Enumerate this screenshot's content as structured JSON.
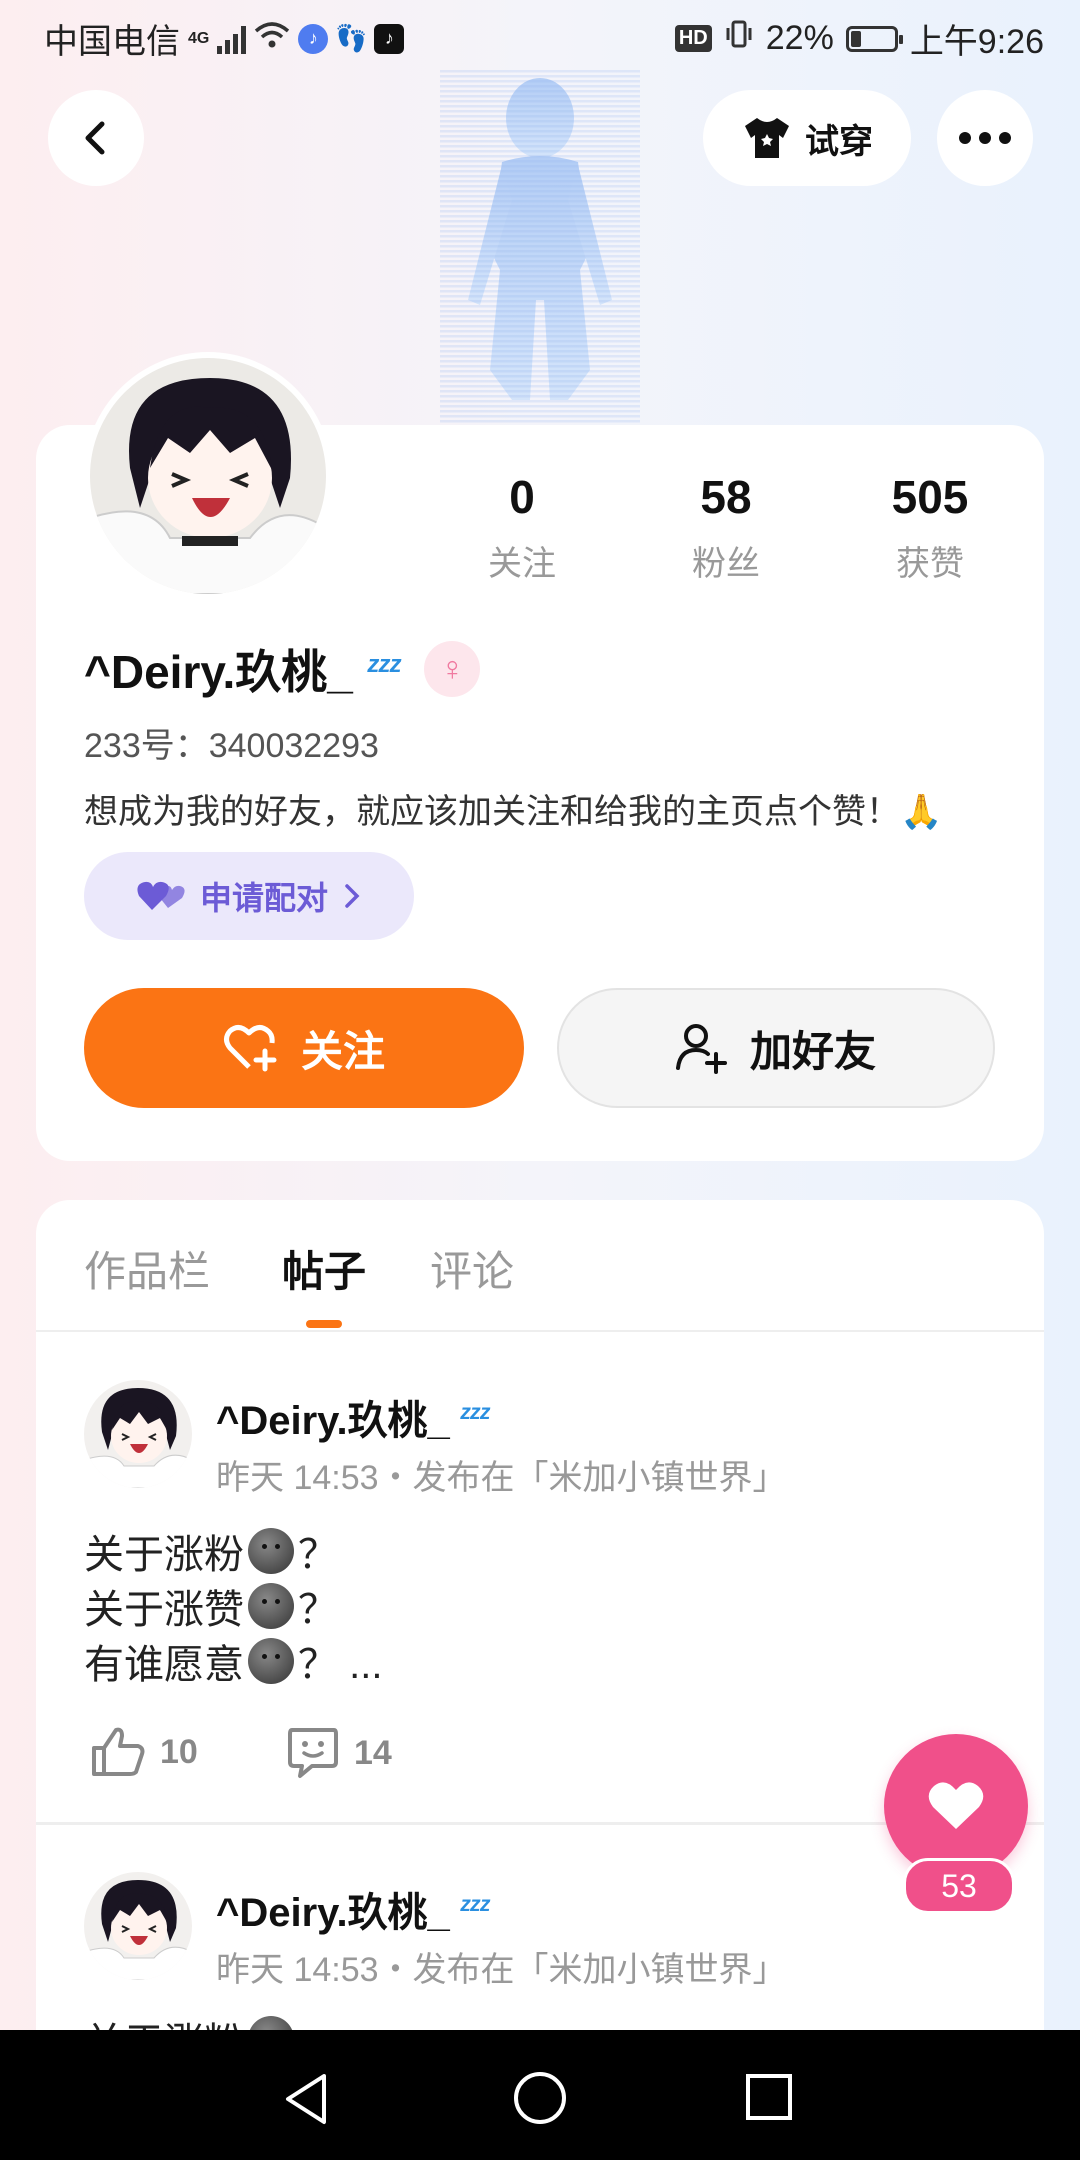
{
  "status_bar": {
    "carrier": "中国电信",
    "network": "4G",
    "hd": "HD",
    "battery": "22%",
    "time": "上午9:26"
  },
  "header": {
    "try_on_label": "试穿"
  },
  "profile": {
    "stats": [
      {
        "value": "0",
        "label": "关注"
      },
      {
        "value": "58",
        "label": "粉丝"
      },
      {
        "value": "505",
        "label": "获赞"
      }
    ],
    "username": "^Deiry.玖桃_",
    "uid": "233号：340032293",
    "bio": "想成为我的好友，就应该加关注和给我的主页点个赞！🙏",
    "pair_label": "申请配对",
    "follow_label": "关注",
    "add_friend_label": "加好友"
  },
  "tabs": [
    {
      "label": "作品栏"
    },
    {
      "label": "帖子"
    },
    {
      "label": "评论"
    }
  ],
  "posts": [
    {
      "author": "^Deiry.玖桃_",
      "meta": "昨天 14:53・发布在「米加小镇世界」",
      "lines": [
        {
          "pre": "关于涨粉",
          "post": "？"
        },
        {
          "pre": "关于涨赞",
          "post": "？"
        },
        {
          "pre": "有谁愿意",
          "post": "？ ..."
        }
      ],
      "likes": "10",
      "comments": "14"
    },
    {
      "author": "^Deiry.玖桃_",
      "meta": "昨天 14:53・发布在「米加小镇世界」",
      "partial_text": "关于涨粉"
    }
  ],
  "fab": {
    "count": "53"
  },
  "colors": {
    "accent": "#fb7414",
    "pink": "#f0508a",
    "purple": "#6c5bd6"
  }
}
